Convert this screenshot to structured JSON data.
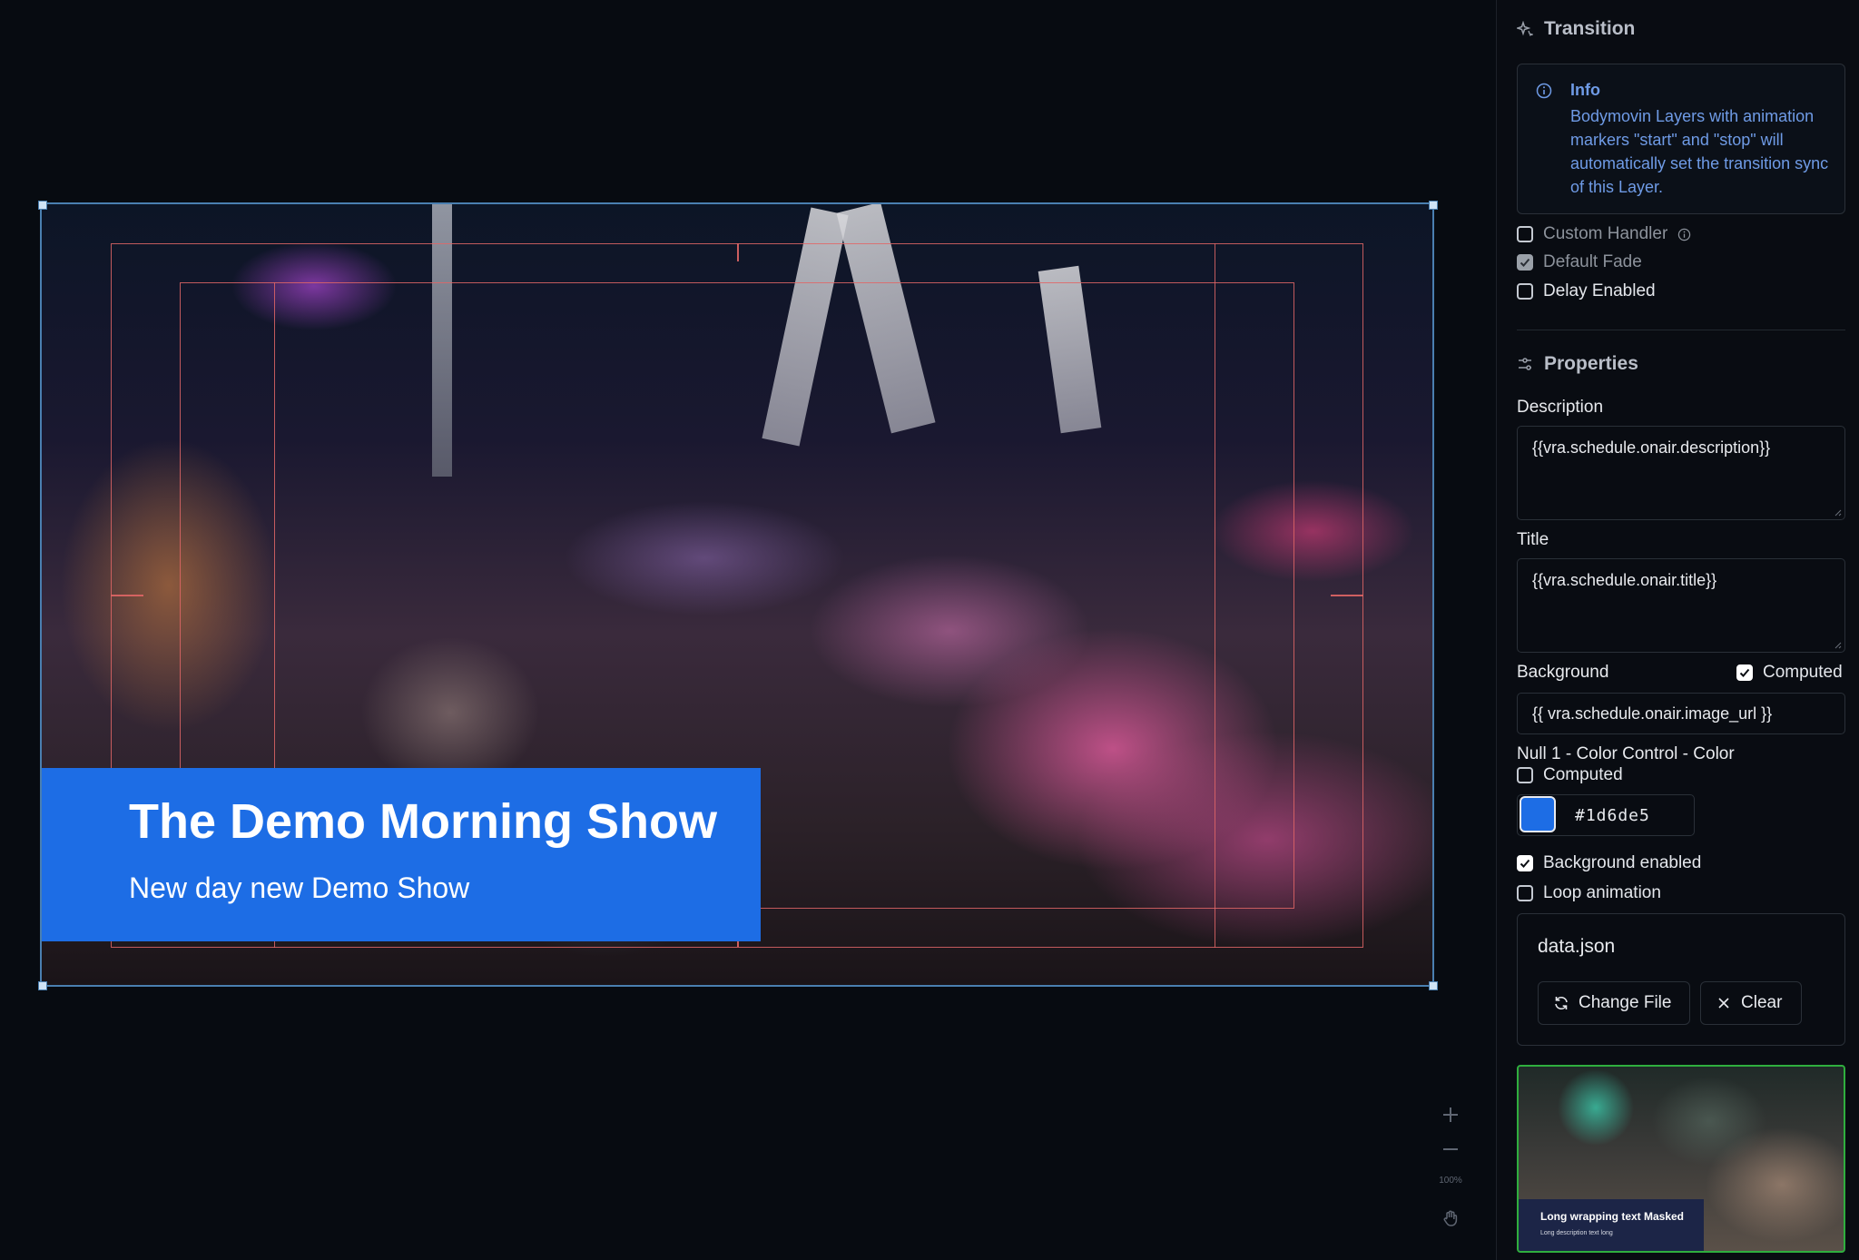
{
  "canvas": {
    "lower_third": {
      "title": "The Demo Morning Show",
      "subtitle": "New day new Demo Show",
      "background_color": "#1d6de5"
    },
    "zoom": {
      "zoom_in_icon": "plus-icon",
      "zoom_out_icon": "minus-icon",
      "zoom_level": "100%",
      "pan_icon": "hand-icon"
    }
  },
  "panel": {
    "transition": {
      "heading": "Transition",
      "info": {
        "title": "Info",
        "text": "Bodymovin Layers with animation markers \"start\" and \"stop\" will automatically set the transition sync of this Layer."
      },
      "options": [
        {
          "label": "Custom Handler",
          "checked": false
        },
        {
          "label": "Default Fade",
          "checked": true
        },
        {
          "label": "Delay Enabled",
          "checked": false
        }
      ]
    },
    "properties": {
      "heading": "Properties",
      "description": {
        "label": "Description",
        "value": "{{vra.schedule.onair.description}}"
      },
      "title": {
        "label": "Title",
        "value": "{{vra.schedule.onair.title}}"
      },
      "background": {
        "label": "Background",
        "computed_label": "Computed",
        "computed": true,
        "value": "{{ vra.schedule.onair.image_url }}"
      },
      "color_control": {
        "label": "Null 1 - Color Control - Color",
        "computed_label": "Computed",
        "computed": false,
        "value": "#1d6de5"
      },
      "background_enabled": {
        "label": "Background enabled",
        "checked": true
      },
      "loop_animation": {
        "label": "Loop animation",
        "checked": false
      },
      "file": {
        "name": "data.json",
        "change_label": "Change File",
        "clear_label": "Clear"
      },
      "preview": {
        "title": "Long wrapping text Masked",
        "subtitle": "Long description text long"
      }
    }
  }
}
